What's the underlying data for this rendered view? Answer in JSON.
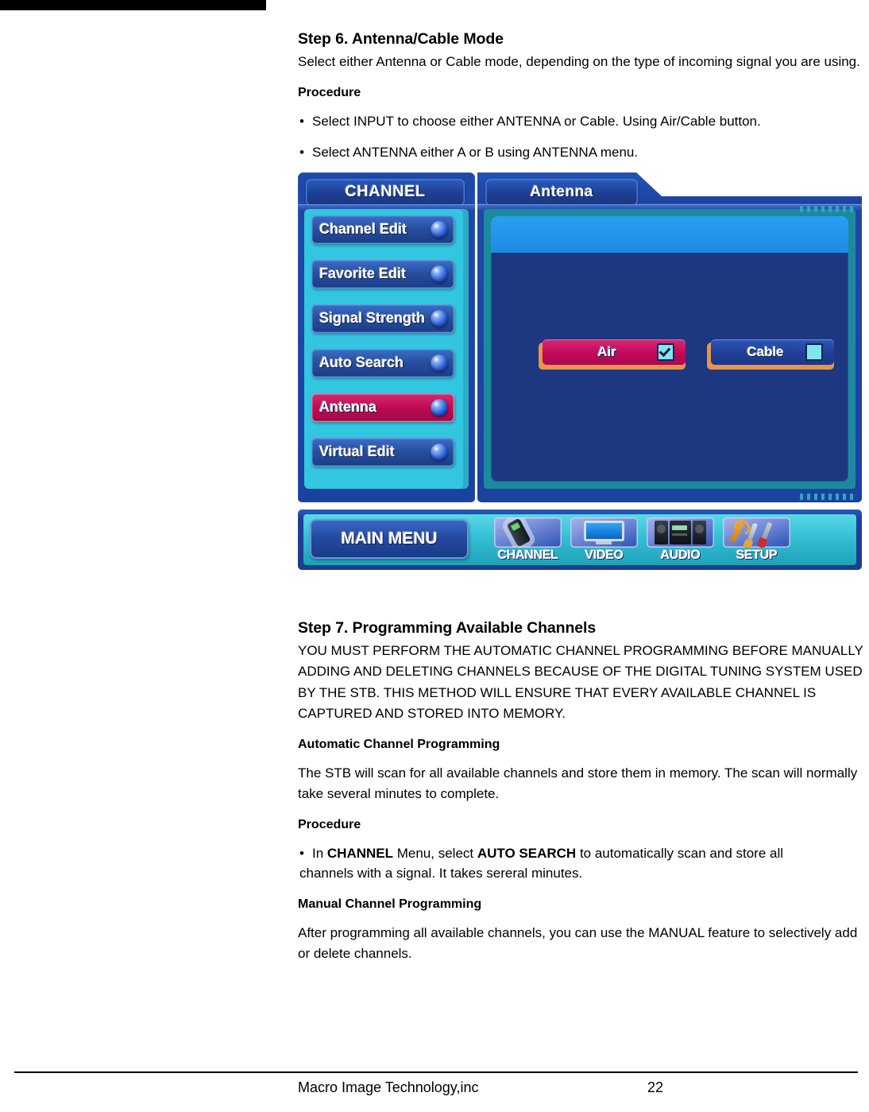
{
  "document": {
    "step6": {
      "title": "Step 6. Antenna/Cable Mode",
      "intro": "Select either Antenna or Cable mode, depending on the type of incoming signal you are using.",
      "procedure_heading": "Procedure",
      "bullets": [
        "Select INPUT to choose either ANTENNA or Cable. Using Air/Cable button.",
        "Select ANTENNA either A or B using ANTENNA menu."
      ]
    },
    "step7": {
      "title": "Step 7. Programming Available Channels",
      "caps_paragraph": "YOU MUST PERFORM THE AUTOMATIC CHANNEL PROGRAMMING BEFORE MANUALLY ADDING AND DELETING CHANNELS BECAUSE OF THE DIGITAL TUNING SYSTEM USED BY THE STB. THIS METHOD WILL ENSURE THAT EVERY AVAILABLE CHANNEL IS CAPTURED AND STORED INTO MEMORY.",
      "auto_heading": "Automatic Channel Programming",
      "auto_body": "The STB will scan for all available channels and store them in memory. The scan will normally take several minutes to complete.",
      "procedure_heading": "Procedure",
      "bullet_prefix": "In ",
      "bullet_bold1": "CHANNEL",
      "bullet_mid": " Menu, select ",
      "bullet_bold2": "AUTO SEARCH",
      "bullet_tail": " to automatically scan and store all",
      "bullet_line2": "channels with a signal.  It takes sereral minutes.",
      "manual_heading": "Manual Channel Programming",
      "manual_body": "After programming all available channels, you can use the MANUAL feature to selectively add or delete channels."
    },
    "footer": {
      "company": "Macro Image Technology,inc",
      "page": "22"
    }
  },
  "osd": {
    "header": {
      "left_tab": "CHANNEL",
      "right_tab": "Antenna"
    },
    "menu_items": [
      {
        "label": "Channel Edit",
        "selected": false
      },
      {
        "label": "Favorite Edit",
        "selected": false
      },
      {
        "label": "Signal Strength",
        "selected": false
      },
      {
        "label": "Auto Search",
        "selected": false
      },
      {
        "label": "Antenna",
        "selected": true
      },
      {
        "label": "Virtual Edit",
        "selected": false
      }
    ],
    "options": [
      {
        "label": "Air",
        "checked": true
      },
      {
        "label": "Cable",
        "checked": false
      }
    ],
    "bottom": {
      "main_menu": "MAIN MENU",
      "nav": [
        {
          "label": "CHANNEL",
          "icon": "remote-control-icon"
        },
        {
          "label": "VIDEO",
          "icon": "monitor-icon"
        },
        {
          "label": "AUDIO",
          "icon": "speakers-icon"
        },
        {
          "label": "SETUP",
          "icon": "tools-icon"
        }
      ]
    },
    "colors": {
      "selected_crimson": "#c2085a",
      "menu_blue": "#27509f",
      "sidebar_cyan": "#33c6e0",
      "panel_navy": "#1d3880",
      "option_shadow_orange": "#e8944a",
      "checkbox_cyan": "#7fe6f0",
      "bottom_bar_cyan": "#35bfd4"
    }
  }
}
